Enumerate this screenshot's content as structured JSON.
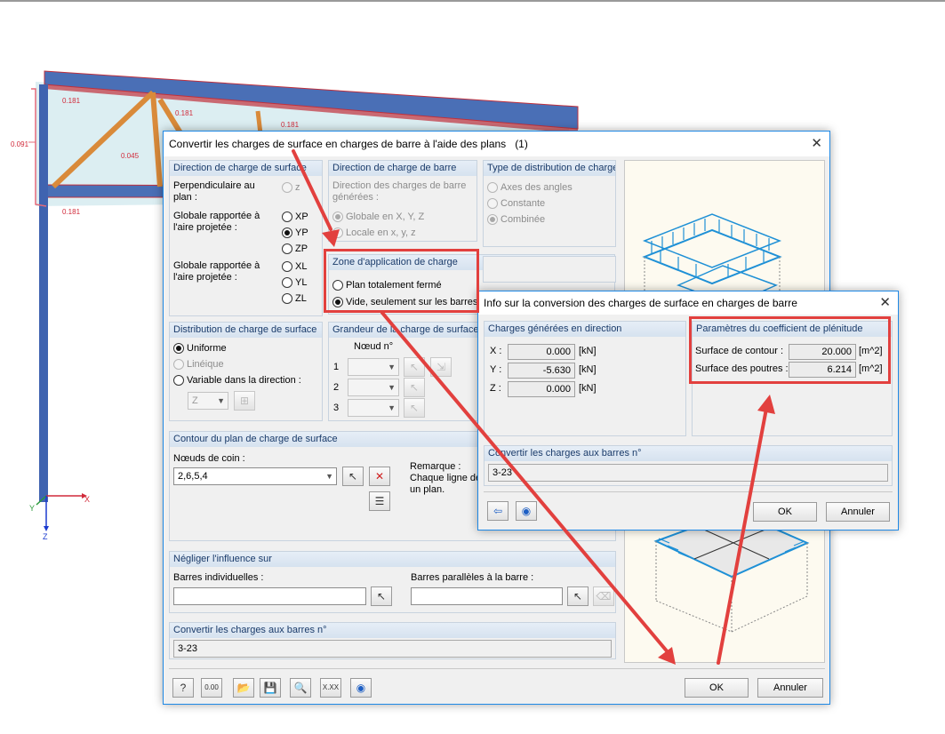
{
  "model": {
    "dims": [
      "0.181",
      "0.181",
      "0.181",
      "0.181",
      "0.091",
      "0.045",
      "0.181"
    ],
    "axes": {
      "x": "X",
      "y": "Y",
      "z": "Z"
    }
  },
  "main_dialog": {
    "title": "Convertir les charges de surface en charges de barre à l'aide des plans",
    "count": "(1)",
    "close": "✕",
    "surface_dir": {
      "title": "Direction de charge de surface",
      "perp_label": "Perpendiculaire au plan :",
      "z": "z",
      "glob_proj_1": "Globale rapportée à l'aire projetée :",
      "xp": "XP",
      "yp": "YP",
      "zp": "ZP",
      "glob_proj_2": "Globale rapportée à l'aire projetée :",
      "xl": "XL",
      "yl": "YL",
      "zl": "ZL"
    },
    "member_dir": {
      "title": "Direction de charge de barre",
      "generated_label": "Direction des charges de barre générées :",
      "global": "Globale en X, Y, Z",
      "local": "Locale en x, y, z"
    },
    "distribution_type": {
      "title": "Type de distribution de charge",
      "angles": "Axes des angles",
      "constant": "Constante",
      "combined": "Combinée"
    },
    "zone": {
      "title": "Zone d'application de charge",
      "closed": "Plan totalement fermé",
      "void": "Vide, seulement sur les barres"
    },
    "surface_dist": {
      "title": "Distribution de charge de surface",
      "uniform": "Uniforme",
      "linear": "Linéique",
      "variable": "Variable dans la direction :",
      "dir_value": "Z"
    },
    "magnitude": {
      "title": "Grandeur de la charge de surface",
      "node_header": "Nœud n°",
      "rows": [
        "1",
        "2",
        "3"
      ]
    },
    "contour": {
      "title": "Contour du plan de charge de surface",
      "corner_label": "Nœuds de coin :",
      "corner_value": "2,6,5,4",
      "remark_label": "Remarque :",
      "remark_text_1": "Chaque ligne de",
      "remark_text_2": "un plan."
    },
    "ignore": {
      "title": "Négliger l'influence sur",
      "individual": "Barres individuelles :",
      "parallel": "Barres parallèles à la barre :"
    },
    "convert": {
      "title": "Convertir les charges aux barres n°",
      "value": "3-23"
    },
    "footer": {
      "ok": "OK",
      "cancel": "Annuler",
      "icons": [
        "help-icon",
        "calculator-icon",
        "open-folder-icon",
        "save-icon",
        "search-icon",
        "decimal-icon",
        "eye-icon"
      ],
      "decimal_label": "0.00",
      "xxx_label": "X.XX"
    }
  },
  "info_dialog": {
    "title": "Info sur la conversion des charges de surface en charges de barre",
    "close": "✕",
    "generated": {
      "title": "Charges générées en direction",
      "x_label": "X :",
      "x_value": "0.000",
      "x_unit": "[kN]",
      "y_label": "Y :",
      "y_value": "-5.630",
      "y_unit": "[kN]",
      "z_label": "Z :",
      "z_value": "0.000",
      "z_unit": "[kN]"
    },
    "fill_coef": {
      "title": "Paramètres du coefficient de plénitude",
      "contour_label": "Surface de contour :",
      "contour_value": "20.000",
      "contour_unit": "[m^2]",
      "beams_label": "Surface des poutres :",
      "beams_value": "6.214",
      "beams_unit": "[m^2]"
    },
    "convert": {
      "title": "Convertir les charges aux barres n°",
      "value": "3-23"
    },
    "ok": "OK",
    "cancel": "Annuler"
  },
  "colors": {
    "accent": "#1e88e5",
    "annotation": "#e2403e",
    "beam_blue": "#4a6fb6",
    "brace_orange": "#d98a3a",
    "load_blue": "#1e90d6"
  }
}
